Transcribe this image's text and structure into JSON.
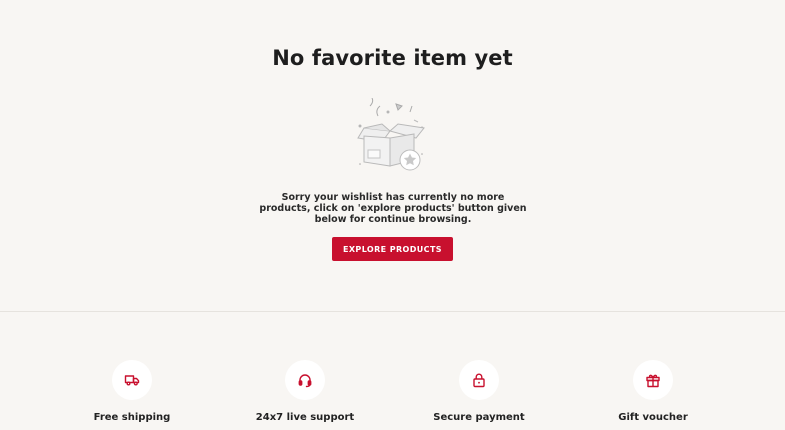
{
  "empty_state": {
    "title": "No favorite item yet",
    "message": "Sorry your wishlist has currently no more products, click on 'explore products' button given below for continue browsing.",
    "button_label": "EXPLORE PRODUCTS"
  },
  "features": [
    {
      "label": "Free shipping",
      "icon": "truck-icon"
    },
    {
      "label": "24x7 live support",
      "icon": "headset-icon"
    },
    {
      "label": "Secure payment",
      "icon": "lock-icon"
    },
    {
      "label": "Gift voucher",
      "icon": "gift-icon"
    }
  ],
  "colors": {
    "accent": "#c8102e",
    "background": "#f8f6f3"
  }
}
